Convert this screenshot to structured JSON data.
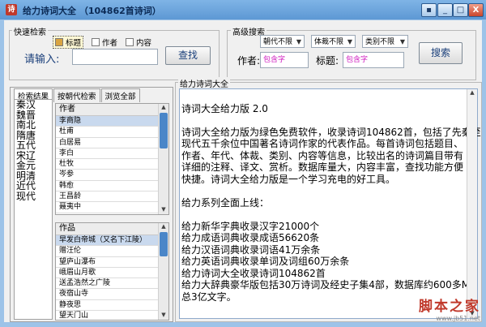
{
  "window": {
    "title": "给力诗词大全  （104862首诗词）",
    "app_icon_text": "诗",
    "minimize": "_",
    "maximize": "□",
    "close": "X",
    "extra": "▪"
  },
  "quick_search": {
    "group_label": "快速检索",
    "options": [
      {
        "label": "标题",
        "checked": true
      },
      {
        "label": "作者",
        "checked": false
      },
      {
        "label": "内容",
        "checked": false
      }
    ],
    "input_label": "请输入:",
    "input_value": "",
    "search_button": "查找"
  },
  "advanced_search": {
    "group_label": "高级搜索",
    "dynasty": "朝代不限",
    "genre": "体裁不限",
    "category": "类别不限",
    "author_label": "作者:",
    "author_placeholder": "包含字",
    "title_label": "标题:",
    "title_placeholder": "包含字",
    "search_button": "搜索"
  },
  "tabs": [
    "检索结果",
    "按朝代检索",
    "浏览全部"
  ],
  "dynasties": [
    "秦汉",
    "魏晋",
    "南北",
    "隋唐",
    "五代",
    "宋辽",
    "金元",
    "明清",
    "近代",
    "现代"
  ],
  "authors": {
    "header": "作者",
    "rows": [
      "李商隐",
      "杜甫",
      "白居易",
      "李白",
      "杜牧",
      "岑参",
      "韩愈",
      "王昌龄",
      "聂夷中"
    ]
  },
  "works": {
    "header": "作品",
    "rows": [
      "早发白帝城（又名下江陵）",
      "赠汪伦",
      "望庐山瀑布",
      "峨眉山月歌",
      "送孟浩然之广陵",
      "夜宿山寺",
      "静夜思",
      "望天门山"
    ]
  },
  "content": {
    "group_label": "给力诗词大全",
    "lines": [
      "",
      "诗词大全给力版 2.0",
      "",
      "诗词大全给力版为绿色免费软件，收录诗词104862首，包括了先秦至",
      "现代五千余位中国著名诗词作家的代表作品。每首诗词包括题目、",
      "作者、年代、体裁、类别、内容等信息，比较出名的诗词篇目带有",
      "详细的注释、译文、赏析。数据库量大，内容丰富，查找功能方便",
      "快捷。诗词大全给力版是一个学习充电的好工具。",
      "",
      "给力系列全面上线：",
      "",
      "给力新华字典收录汉字21000个",
      "给力成语词典收录成语56620条",
      "给力汉语词典收录词语41万余条",
      "给力英语词典收录单词及词组60万余条",
      "给力诗词大全收录诗词104862首",
      "给力大辞典豪华版包括30万诗词及经史子集4部，数据库约600多M，",
      "总3亿文字。"
    ]
  },
  "watermark": {
    "main": "脚本之家",
    "sub": "www.jb51.net"
  },
  "colors": {
    "title_bar": "#5d98d4",
    "accent_text": "#1a3f7a",
    "placeholder": "#d020c0",
    "watermark": "#c0392b",
    "scroll_thumb": "#4a86c8"
  }
}
